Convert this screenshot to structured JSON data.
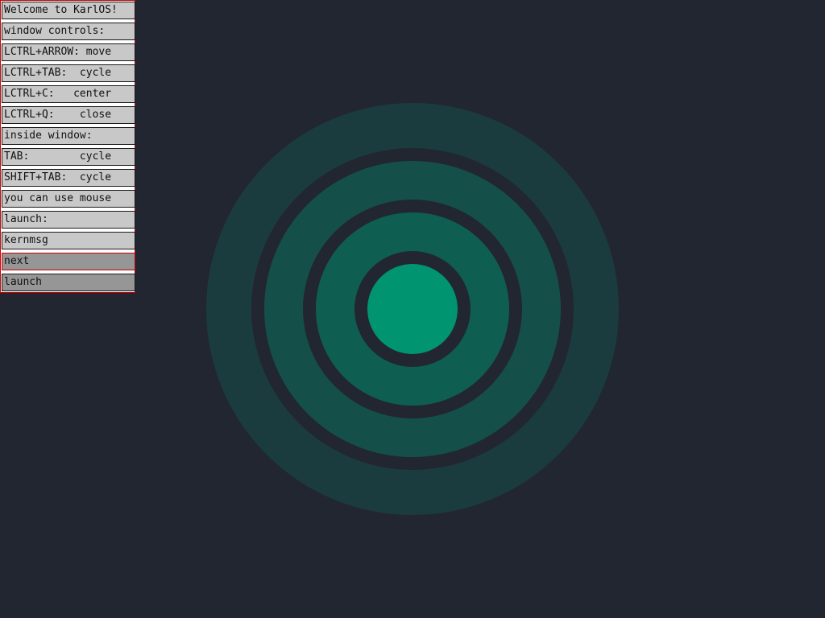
{
  "wallpaper": {
    "background_color": "#222631",
    "ring_colors": {
      "outer": "#1b3c3f",
      "mid": "#145049",
      "inner": "#0f5e52",
      "core": "#009470"
    }
  },
  "window": {
    "border_color": "#cc0000",
    "lines": [
      "Welcome to KarlOS!",
      "window controls:",
      "LCTRL+ARROW: move",
      "LCTRL+TAB:  cycle",
      "LCTRL+C:   center",
      "LCTRL+Q:    close",
      "inside window:",
      "TAB:        cycle",
      "SHIFT+TAB:  cycle",
      "you can use mouse",
      "launch:"
    ],
    "program_field_value": "kernmsg",
    "next_button_label": "next",
    "launch_button_label": "launch"
  }
}
